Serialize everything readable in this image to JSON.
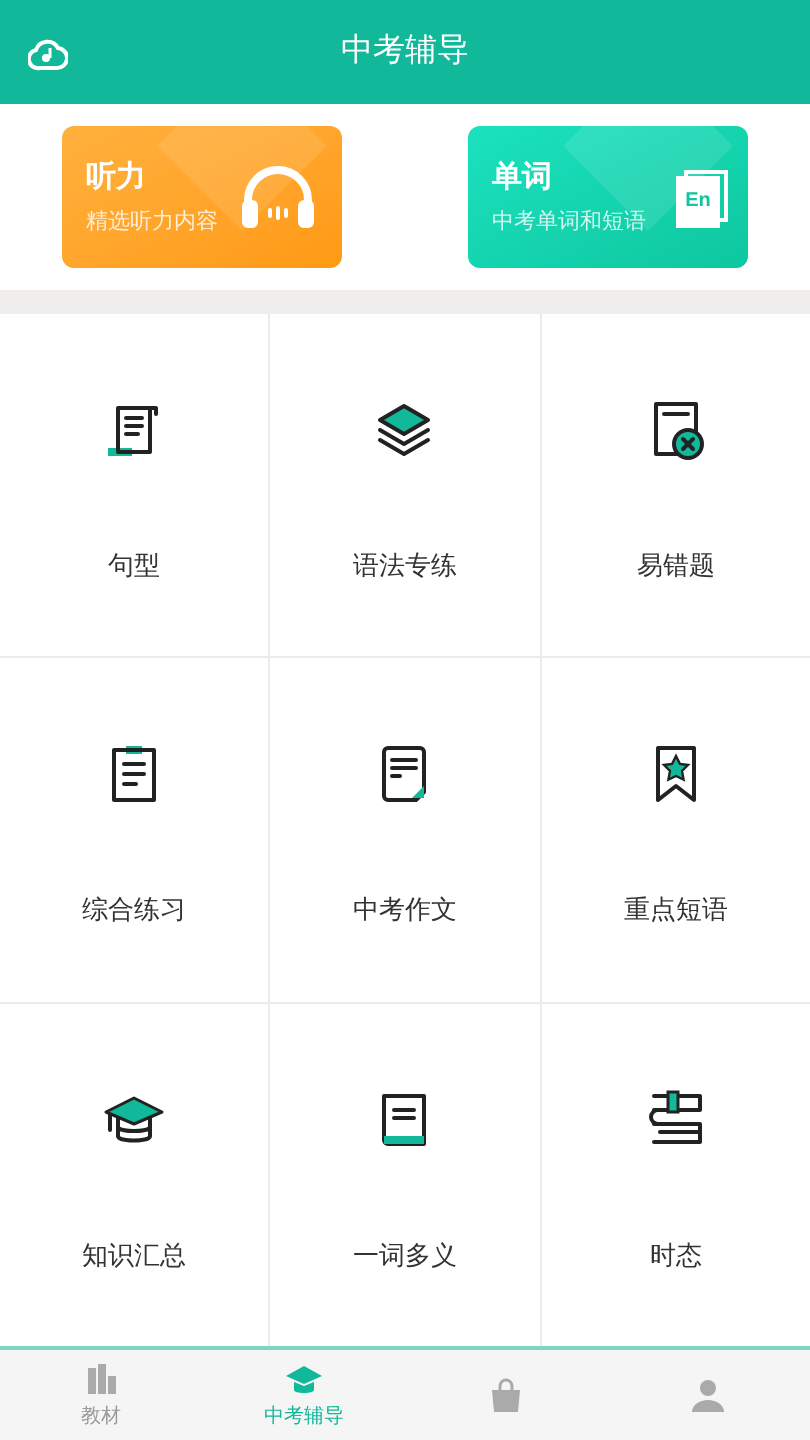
{
  "header": {
    "title": "中考辅导"
  },
  "cards": [
    {
      "kind": "listening",
      "title": "听力",
      "subtitle": "精选听力内容"
    },
    {
      "kind": "words",
      "title": "单词",
      "subtitle": "中考单词和短语",
      "badge": "En"
    }
  ],
  "grid": [
    {
      "kind": "scroll",
      "label": "句型"
    },
    {
      "kind": "layers",
      "label": "语法专练"
    },
    {
      "kind": "wrong",
      "label": "易错题"
    },
    {
      "kind": "clipboard",
      "label": "综合练习"
    },
    {
      "kind": "document",
      "label": "中考作文"
    },
    {
      "kind": "bookmark",
      "label": "重点短语"
    },
    {
      "kind": "cap",
      "label": "知识汇总"
    },
    {
      "kind": "book",
      "label": "一词多义"
    },
    {
      "kind": "books",
      "label": "时态"
    }
  ],
  "tabs": [
    {
      "kind": "books",
      "label": "教材",
      "selected": false
    },
    {
      "kind": "cap",
      "label": "中考辅导",
      "selected": true
    },
    {
      "kind": "bag",
      "selected": false
    },
    {
      "kind": "person",
      "selected": false
    }
  ]
}
